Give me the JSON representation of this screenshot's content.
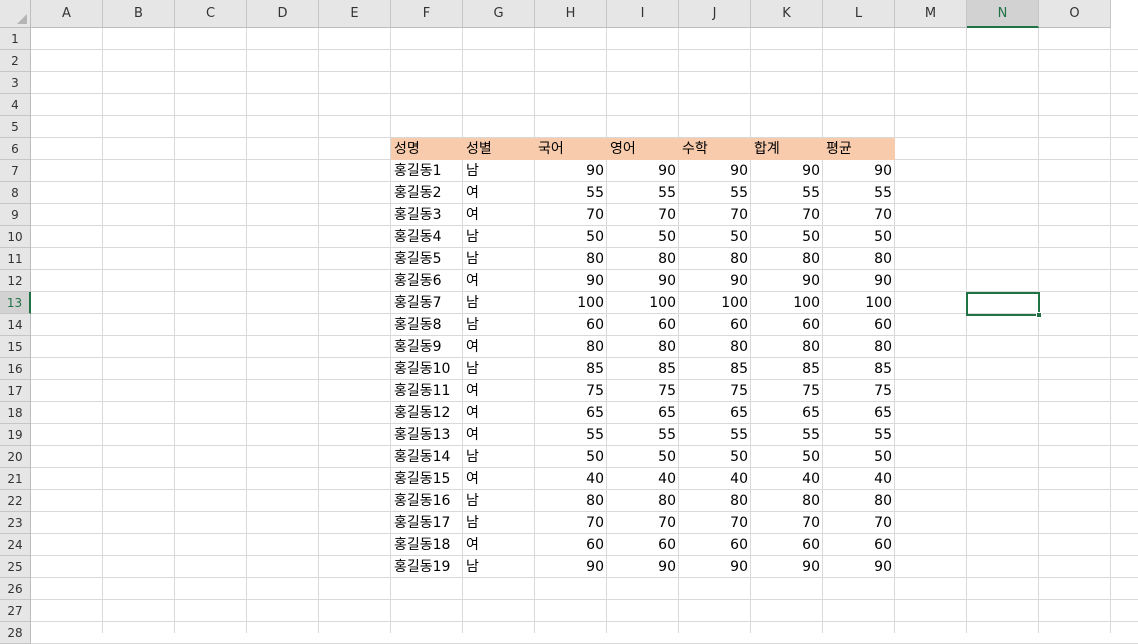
{
  "columns": [
    "A",
    "B",
    "C",
    "D",
    "E",
    "F",
    "G",
    "H",
    "I",
    "J",
    "K",
    "L",
    "M",
    "N",
    "O"
  ],
  "rows": [
    "1",
    "2",
    "3",
    "4",
    "5",
    "6",
    "7",
    "8",
    "9",
    "10",
    "11",
    "12",
    "13",
    "14",
    "15",
    "16",
    "17",
    "18",
    "19",
    "20",
    "21",
    "22",
    "23",
    "24",
    "25",
    "26",
    "27",
    "28"
  ],
  "selected_cell": {
    "column": "N",
    "row": "13"
  },
  "accent_color": "#217346",
  "header_fill_color": "#f8cbad",
  "table": {
    "headers": [
      "성명",
      "성별",
      "국어",
      "영어",
      "수학",
      "합계",
      "평균"
    ],
    "rows": [
      [
        "홍길동1",
        "남",
        "90",
        "90",
        "90",
        "90",
        "90"
      ],
      [
        "홍길동2",
        "여",
        "55",
        "55",
        "55",
        "55",
        "55"
      ],
      [
        "홍길동3",
        "여",
        "70",
        "70",
        "70",
        "70",
        "70"
      ],
      [
        "홍길동4",
        "남",
        "50",
        "50",
        "50",
        "50",
        "50"
      ],
      [
        "홍길동5",
        "남",
        "80",
        "80",
        "80",
        "80",
        "80"
      ],
      [
        "홍길동6",
        "여",
        "90",
        "90",
        "90",
        "90",
        "90"
      ],
      [
        "홍길동7",
        "남",
        "100",
        "100",
        "100",
        "100",
        "100"
      ],
      [
        "홍길동8",
        "남",
        "60",
        "60",
        "60",
        "60",
        "60"
      ],
      [
        "홍길동9",
        "여",
        "80",
        "80",
        "80",
        "80",
        "80"
      ],
      [
        "홍길동10",
        "남",
        "85",
        "85",
        "85",
        "85",
        "85"
      ],
      [
        "홍길동11",
        "여",
        "75",
        "75",
        "75",
        "75",
        "75"
      ],
      [
        "홍길동12",
        "여",
        "65",
        "65",
        "65",
        "65",
        "65"
      ],
      [
        "홍길동13",
        "여",
        "55",
        "55",
        "55",
        "55",
        "55"
      ],
      [
        "홍길동14",
        "남",
        "50",
        "50",
        "50",
        "50",
        "50"
      ],
      [
        "홍길동15",
        "여",
        "40",
        "40",
        "40",
        "40",
        "40"
      ],
      [
        "홍길동16",
        "남",
        "80",
        "80",
        "80",
        "80",
        "80"
      ],
      [
        "홍길동17",
        "남",
        "70",
        "70",
        "70",
        "70",
        "70"
      ],
      [
        "홍길동18",
        "여",
        "60",
        "60",
        "60",
        "60",
        "60"
      ],
      [
        "홍길동19",
        "남",
        "90",
        "90",
        "90",
        "90",
        "90"
      ]
    ]
  }
}
